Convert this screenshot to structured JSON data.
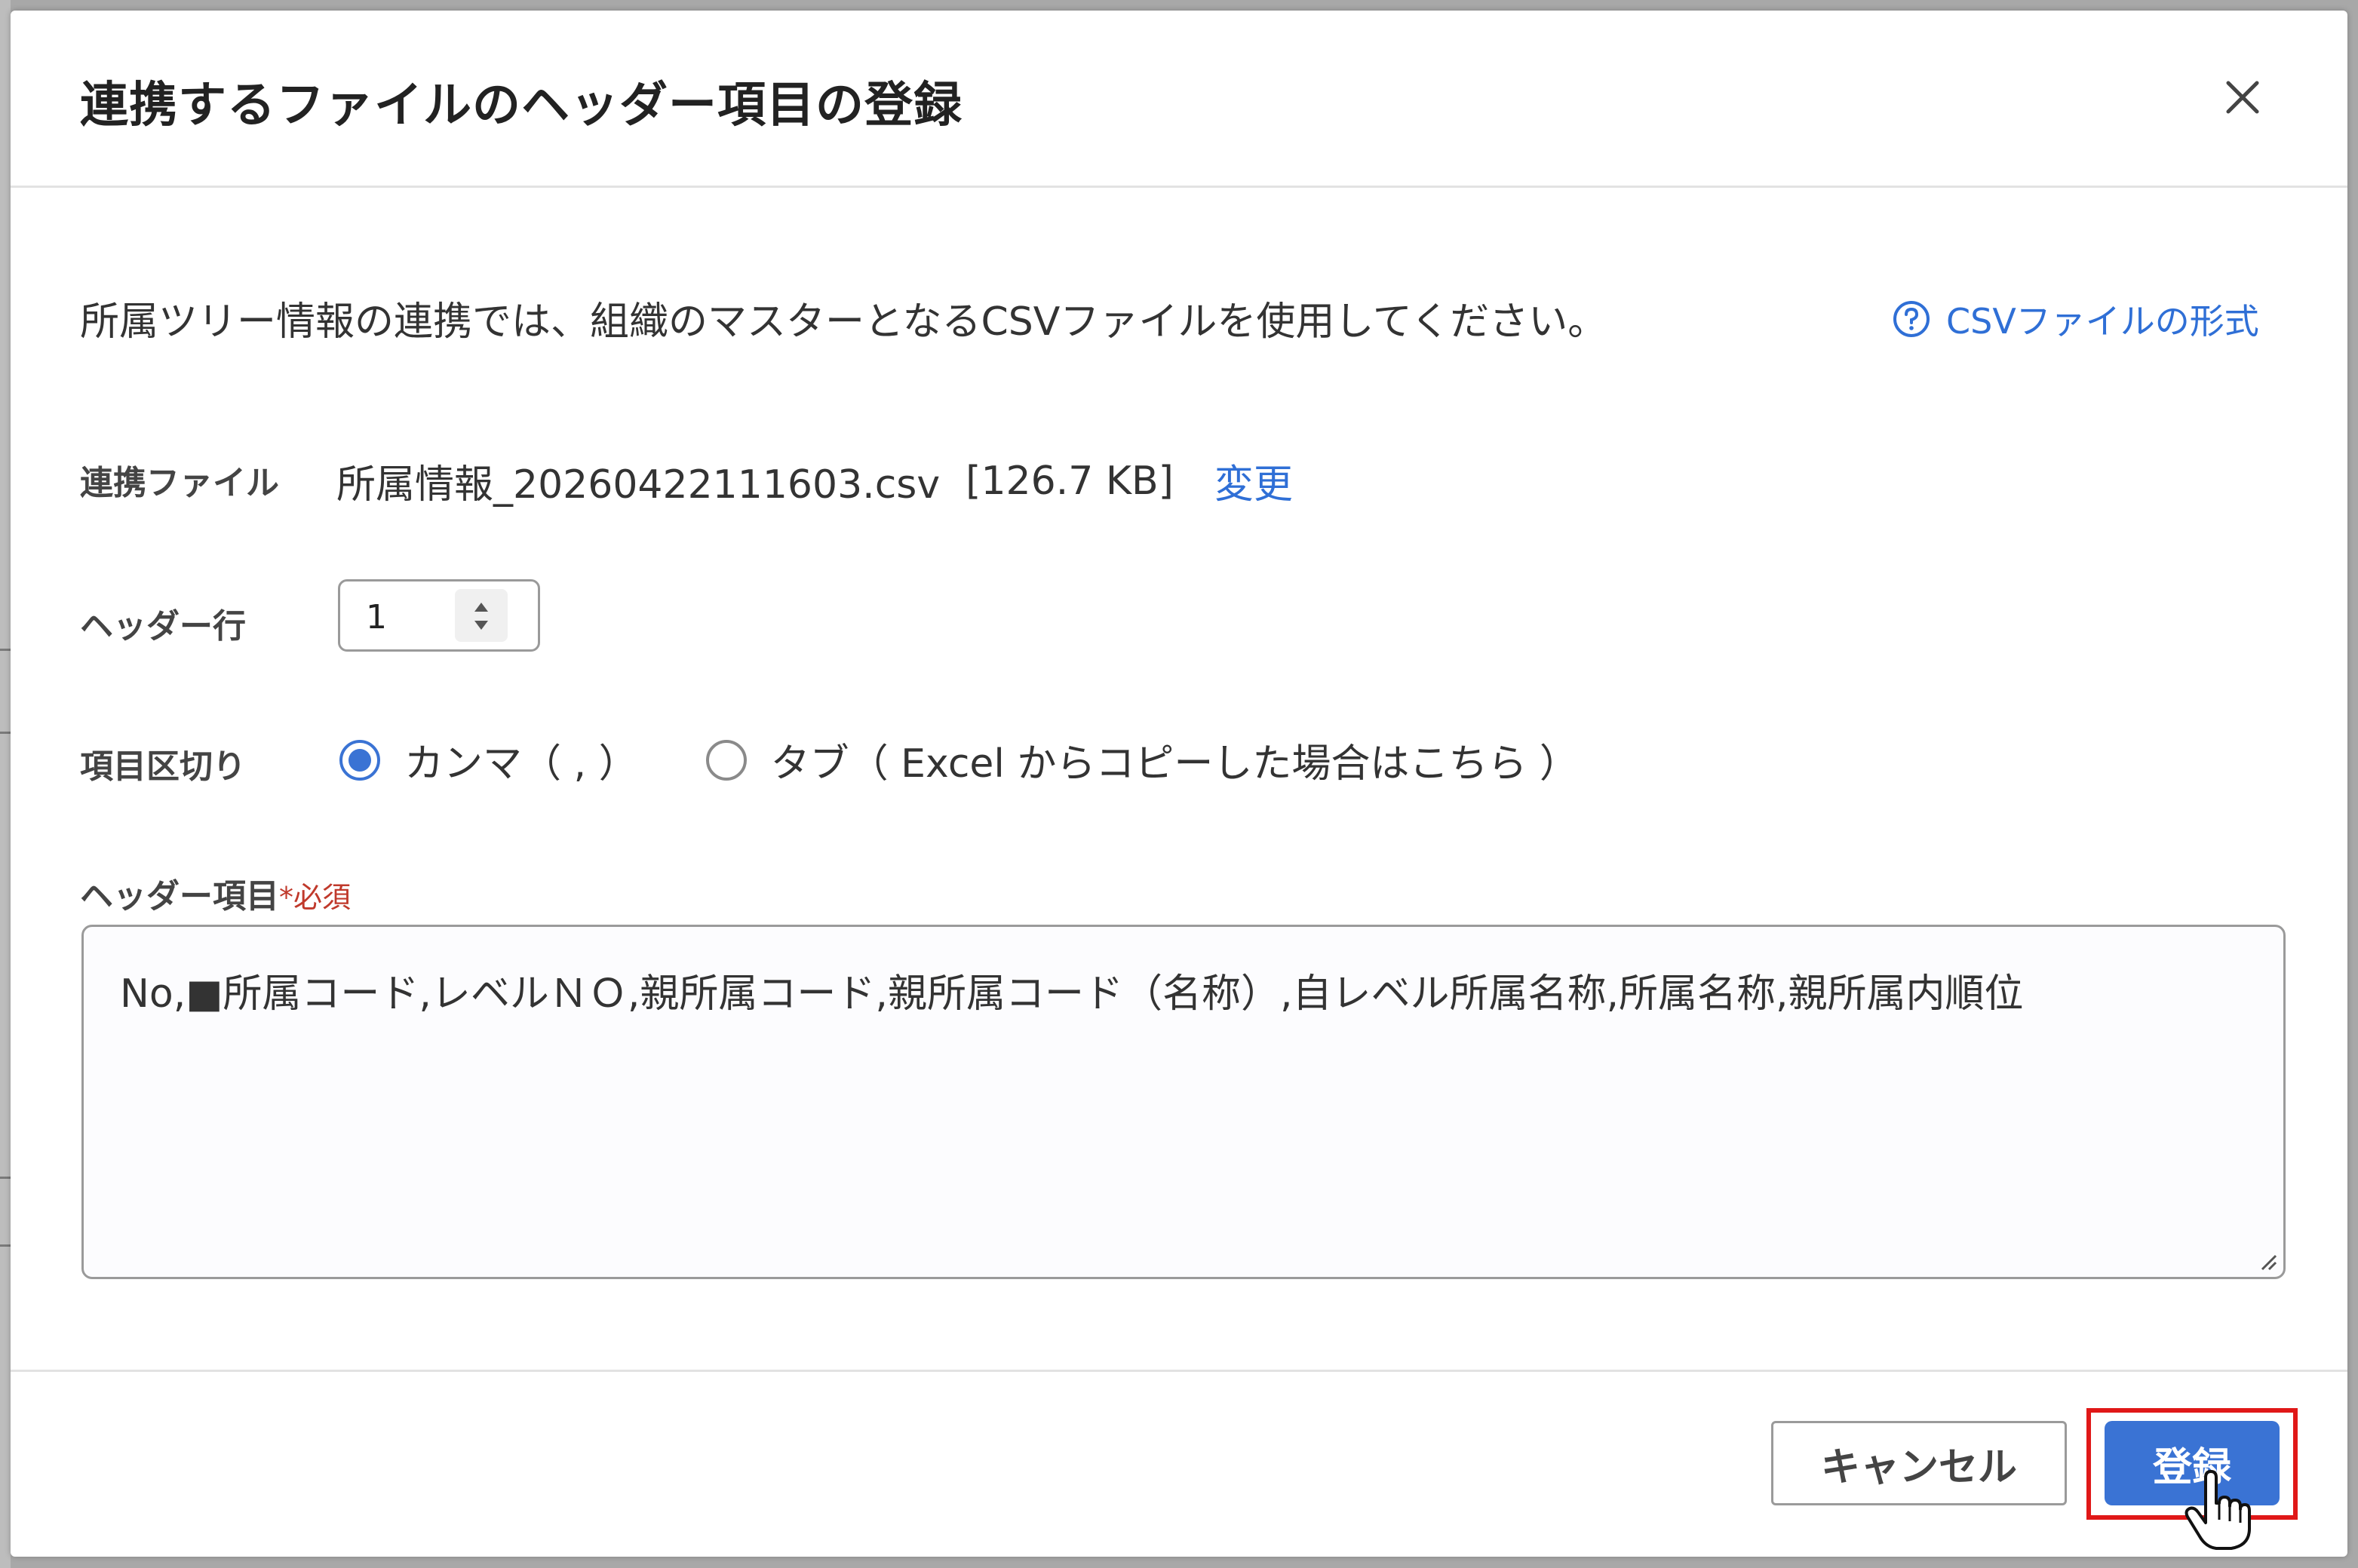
{
  "dialog": {
    "title": "連携するファイルのヘッダー項目の登録",
    "description": "所属ツリー情報の連携では、組織のマスターとなるCSVファイルを使用してください。",
    "help_link": "CSVファイルの形式"
  },
  "file": {
    "label": "連携ファイル",
    "name": "所属情報_20260422111603.csv",
    "size": "[126.7 KB]",
    "change_link": "変更"
  },
  "header_row": {
    "label": "ヘッダー行",
    "value": "1"
  },
  "delimiter": {
    "label": "項目区切り",
    "options": [
      {
        "label": "カンマ（ , ）",
        "selected": true
      },
      {
        "label": "タブ（ Excel からコピーした場合はこちら ）",
        "selected": false
      }
    ]
  },
  "header_items": {
    "label": "ヘッダー項目",
    "required_mark": "*",
    "required_text": "必須",
    "value": "No,■所属コード,レベルＮＯ,親所属コード,親所属コード（名称）,自レベル所属名称,所属名称,親所属内順位"
  },
  "footer": {
    "cancel_label": "キャンセル",
    "submit_label": "登録"
  },
  "colors": {
    "accent": "#3a73d4",
    "link": "#2f6fd6",
    "required": "#c0392b",
    "highlight": "#e01818"
  },
  "icons": {
    "close": "close-icon",
    "help": "question-circle-icon",
    "stepper": "up-down-arrows-icon",
    "cursor": "hand-pointer-icon"
  }
}
